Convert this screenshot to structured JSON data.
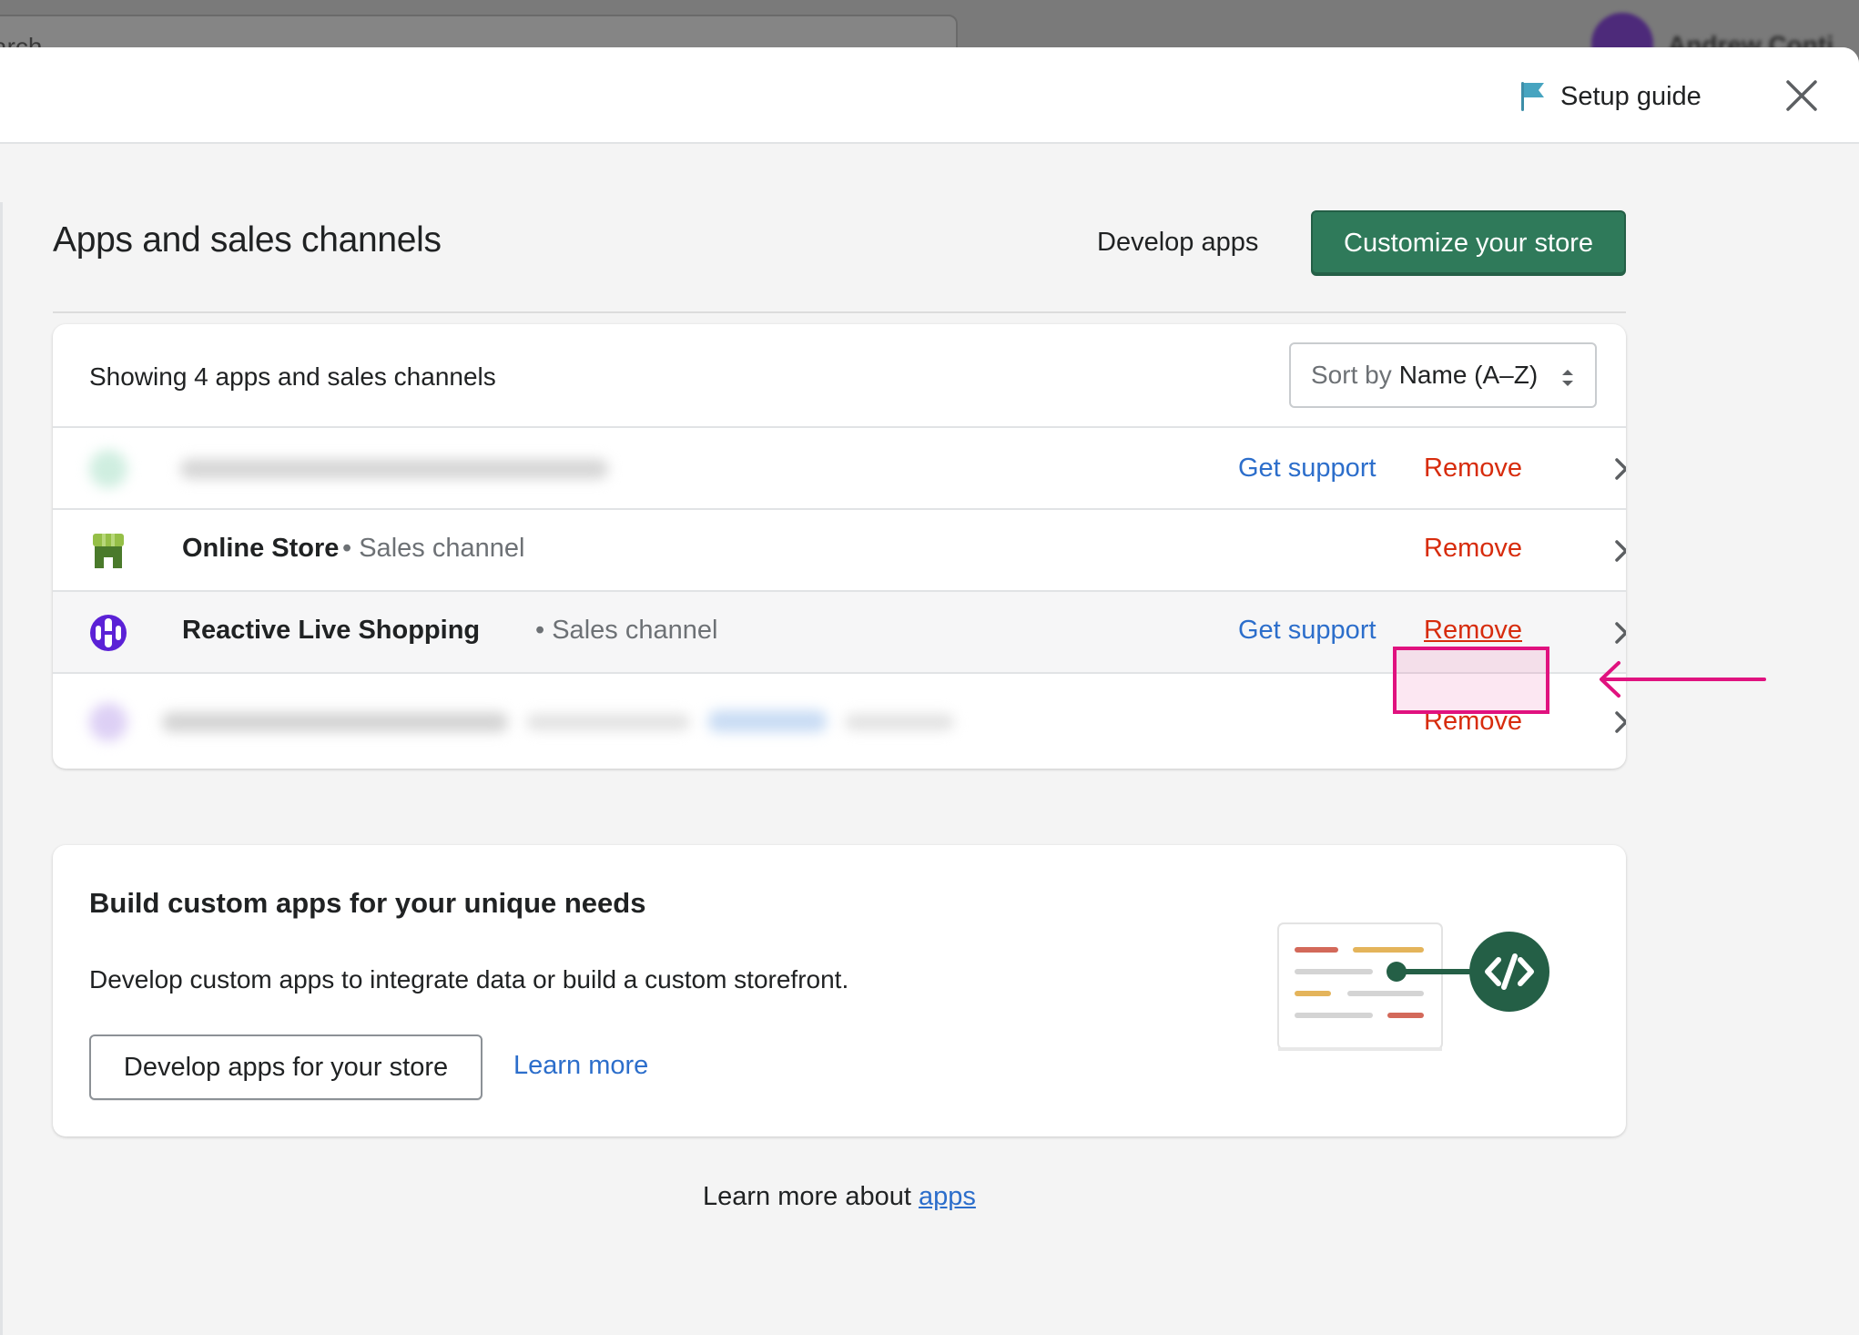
{
  "background": {
    "search_placeholder": "arch",
    "user_name": "Andrew Conti"
  },
  "header": {
    "setup_guide_label": "Setup guide",
    "close_icon": "close-icon",
    "flag_icon": "flag-icon"
  },
  "page": {
    "title": "Apps and sales channels",
    "develop_apps_label": "Develop apps",
    "customize_label": "Customize your store"
  },
  "apps_list": {
    "showing_text": "Showing 4 apps and sales channels",
    "sort_prefix": "Sort by",
    "sort_value": "Name (A–Z)",
    "get_support_label": "Get support",
    "remove_label": "Remove",
    "items": [
      {
        "name": "",
        "type": "",
        "has_support": true,
        "blurred": true
      },
      {
        "name": "Online Store",
        "type": "Sales channel",
        "has_support": false,
        "blurred": false,
        "icon": "storefront-icon"
      },
      {
        "name": "Reactive Live Shopping",
        "type": "Sales channel",
        "has_support": true,
        "blurred": false,
        "icon": "live-shopping-icon",
        "highlighted": true
      },
      {
        "name": "",
        "type": "",
        "has_support": false,
        "blurred": true
      }
    ]
  },
  "build_card": {
    "title": "Build custom apps for your unique needs",
    "description": "Develop custom apps to integrate data or build a custom storefront.",
    "button_label": "Develop apps for your store",
    "learn_more_label": "Learn more"
  },
  "footer": {
    "prefix": "Learn more about",
    "link": "apps"
  },
  "colors": {
    "primary": "#2f7a5a",
    "link": "#2c6ecb",
    "critical": "#d72c0d",
    "annotation": "#e0127f"
  }
}
